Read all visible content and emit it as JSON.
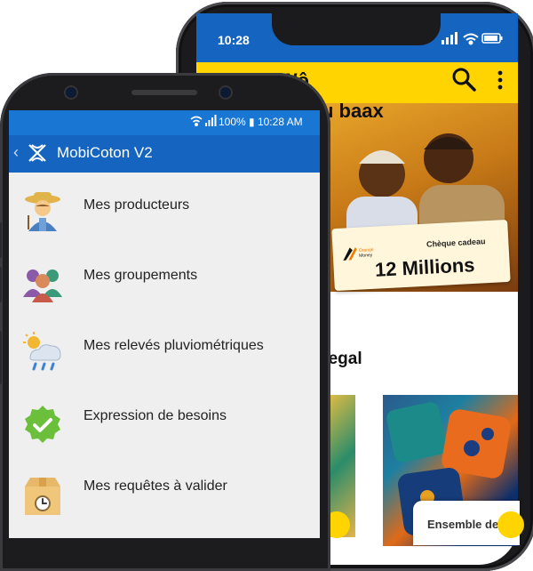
{
  "back_phone": {
    "status": {
      "time": "10:28"
    },
    "header": {
      "brand_text": "ƐWô"
    },
    "banner": {
      "title": "u baax",
      "card_label": "Chèque cadeau",
      "card_amount": "12 Millions",
      "logo_text": "Orange Money"
    },
    "section_title": "negal",
    "product_card_title": "Ensemble de"
  },
  "front_phone": {
    "status": {
      "text": "100% ▮ 10:28 AM"
    },
    "app": {
      "title": "MobiCoton V2"
    },
    "menu": [
      {
        "label": "Mes producteurs",
        "icon": "farmer-icon"
      },
      {
        "label": "Mes groupements",
        "icon": "group-icon"
      },
      {
        "label": "Mes relevés pluviométriques",
        "icon": "rain-cloud-icon"
      },
      {
        "label": "Expression de besoins",
        "icon": "check-badge-icon"
      },
      {
        "label": "Mes requêtes à valider",
        "icon": "box-clock-icon"
      }
    ]
  },
  "colors": {
    "android_bar": "#1565c0",
    "android_status": "#1976d2",
    "ios_status": "#1565c0",
    "accent_yellow": "#ffd400",
    "menu_bg": "#efefef"
  }
}
